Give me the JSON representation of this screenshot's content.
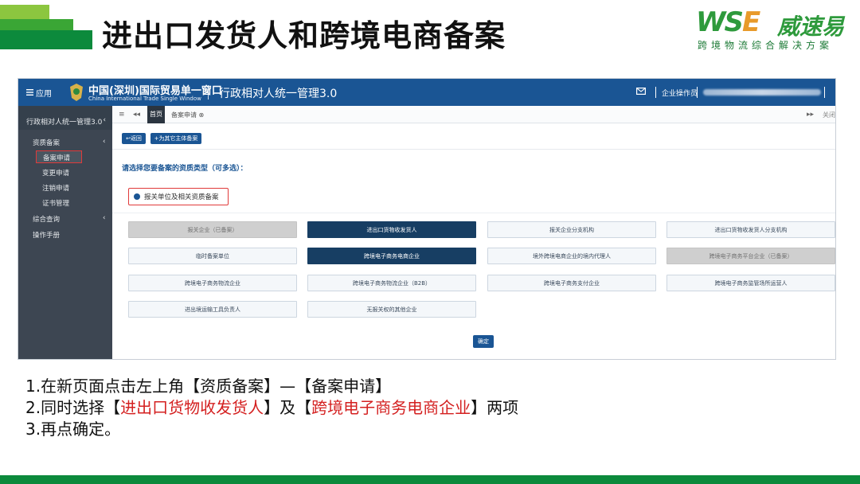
{
  "slide": {
    "title": "进出口发货人和跨境电商备案",
    "colors": {
      "title": "#111111",
      "green_dark": "#0c8a3c",
      "green_mid": "#3aa635",
      "green_light": "#8cc63f",
      "highlight_red": "#d42020"
    }
  },
  "logo": {
    "mark_part1": "WS",
    "mark_part2": "E",
    "chinese": "威速易",
    "slogan": "跨境物流综合解决方案"
  },
  "app": {
    "topbar": {
      "menu_icon": "hamburger-icon",
      "menu_label": "应用",
      "site_name": "中国(深圳)国际贸易单一窗口",
      "site_name_en": "China International Trade Single Window",
      "system_name": "行政相对人统一管理3.0",
      "mail_icon": "mail-icon",
      "operator_label": "企业操作员",
      "color": "#1a5594"
    },
    "sidebar": {
      "title": "行政相对人统一管理3.0",
      "title_chevron": "‹",
      "groups": [
        {
          "label": "资质备案",
          "chevron": "‹"
        },
        {
          "label": "综合查询",
          "chevron": "‹"
        },
        {
          "label": "操作手册"
        }
      ],
      "sub_items": [
        "备案申请",
        "变更申请",
        "注销申请",
        "证书管理"
      ]
    },
    "tabs": {
      "menu_icon": "≡",
      "prev_icon": "◂◂",
      "home": "首页",
      "active": "备案申请",
      "active_close": "⊗",
      "next_icon": "▸▸",
      "close_label": "关闭"
    },
    "toolbar": {
      "back_label": "返回",
      "bind_label": "为其它主体备案"
    },
    "prompt": "请选择您要备案的资质类型（可多选）：",
    "type_option": "报关单位及相关资质备案",
    "qualifications": [
      {
        "label": "报关企业（已备案）",
        "state": "disabled"
      },
      {
        "label": "进出口货物收发货人",
        "state": "selected"
      },
      {
        "label": "报关企业分支机构",
        "state": "normal"
      },
      {
        "label": "进出口货物收发货人分支机构",
        "state": "normal"
      },
      {
        "label": "临时备案单位",
        "state": "normal"
      },
      {
        "label": "跨境电子商务电商企业",
        "state": "selected"
      },
      {
        "label": "境外跨境电商企业的境内代理人",
        "state": "normal"
      },
      {
        "label": "跨境电子商务平台企业（已备案）",
        "state": "disabled"
      },
      {
        "label": "跨境电子商务物流企业",
        "state": "normal"
      },
      {
        "label": "跨境电子商务物流企业（B2B）",
        "state": "normal"
      },
      {
        "label": "跨境电子商务支付企业",
        "state": "normal"
      },
      {
        "label": "跨境电子商务监管场所运营人",
        "state": "normal"
      },
      {
        "label": "进出境运输工具负责人",
        "state": "normal"
      },
      {
        "label": "无报关权的其他企业",
        "state": "normal"
      }
    ],
    "confirm_label": "确定"
  },
  "instructions": {
    "line1": "1.在新页面点击左上角【资质备案】—【备案申请】",
    "line2_a": "2.同时选择【",
    "line2_red1": "进出口货物收发货人",
    "line2_b": "】及【",
    "line2_red2": "跨境电子商务电商企业",
    "line2_c": "】两项",
    "line3": "3.再点确定。"
  }
}
